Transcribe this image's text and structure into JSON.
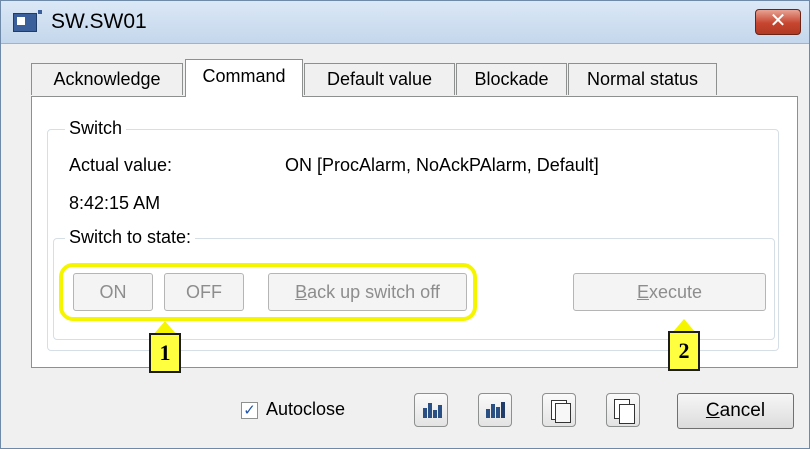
{
  "window": {
    "title": "SW.SW01",
    "close_label": "✕"
  },
  "tabs": [
    {
      "label": "Acknowledge"
    },
    {
      "label": "Command"
    },
    {
      "label": "Default value"
    },
    {
      "label": "Blockade"
    },
    {
      "label": "Normal status"
    }
  ],
  "active_tab": "Command",
  "switch_group": {
    "label": "Switch",
    "actual_value_label": "Actual value:",
    "actual_value": "ON [ProcAlarm, NoAckPAlarm, Default]",
    "time": "8:42:15 AM",
    "switch_to_state_label": "Switch to state:"
  },
  "buttons": {
    "on": "ON",
    "off": "OFF",
    "backup_first": "B",
    "backup_rest": "ack up switch off",
    "execute_first": "E",
    "execute_rest": "xecute"
  },
  "callouts": {
    "one": "1",
    "two": "2"
  },
  "footer": {
    "autoclose_label": "Autoclose",
    "autoclose_checked": true,
    "cancel_first": "C",
    "cancel_rest": "ancel"
  },
  "icons": [
    "app-window-icon",
    "close-icon",
    "bar-chart-icon",
    "bar-chart-plus-icon",
    "document-edit-icon",
    "copy-icon"
  ],
  "colors": {
    "highlight": "#f5f500",
    "callout_fill": "#ffff40",
    "title_bar": "#c4d7ec",
    "close_button": "#c6452f"
  }
}
